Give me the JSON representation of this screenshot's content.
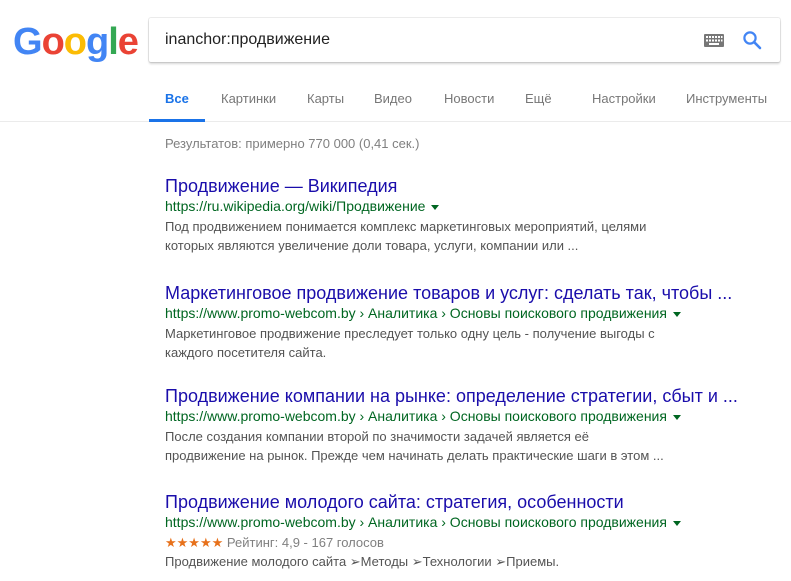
{
  "logo": {
    "letters": [
      "G",
      "o",
      "o",
      "g",
      "l",
      "e"
    ],
    "colors": [
      "#4285f4",
      "#ea4335",
      "#fbbc05",
      "#4285f4",
      "#34a853",
      "#ea4335"
    ]
  },
  "search": {
    "query": "inanchor:продвижение"
  },
  "icons": {
    "keyboard": "keyboard-icon",
    "search": "search-icon"
  },
  "tabs": [
    {
      "label": "Все"
    },
    {
      "label": "Картинки"
    },
    {
      "label": "Карты"
    },
    {
      "label": "Видео"
    },
    {
      "label": "Новости"
    },
    {
      "label": "Ещё"
    },
    {
      "label": "Настройки"
    },
    {
      "label": "Инструменты"
    }
  ],
  "stats": "Результатов: примерно 770 000 (0,41 сек.)",
  "results": [
    {
      "title": "Продвижение — Википедия",
      "url": "https://ru.wikipedia.org/wiki/Продвижение",
      "snippet_lines": [
        "Под продвижением понимается комплекс маркетинговых мероприятий, целями",
        "которых являются увеличение доли товара, услуги, компании или ..."
      ]
    },
    {
      "title": "Маркетинговое продвижение товаров и услуг: сделать так, чтобы ...",
      "url": "https://www.promo-webcom.by › Аналитика › Основы поискового продвижения",
      "snippet_lines": [
        "Маркетинговое продвижение преследует только одну цель - получение выгоды с",
        "каждого посетителя сайта."
      ]
    },
    {
      "title": "Продвижение компании на рынке: определение стратегии, сбыт и ...",
      "url": "https://www.promo-webcom.by › Аналитика › Основы поискового продвижения",
      "snippet_lines": [
        "После создания компании второй по значимости задачей является её",
        "продвижение на рынок. Прежде чем начинать делать практические шаги в этом ..."
      ]
    },
    {
      "title": "Продвижение молодого сайта: стратегия, особенности",
      "url": "https://www.promo-webcom.by › Аналитика › Основы поискового продвижения",
      "rating": {
        "stars": "★★★★★",
        "text": "Рейтинг: 4,9 - 167 голосов",
        "value": 4.9
      },
      "snippet_lines": [
        "Продвижение молодого сайта ➢Методы ➢Технологии ➢Приемы."
      ]
    }
  ]
}
